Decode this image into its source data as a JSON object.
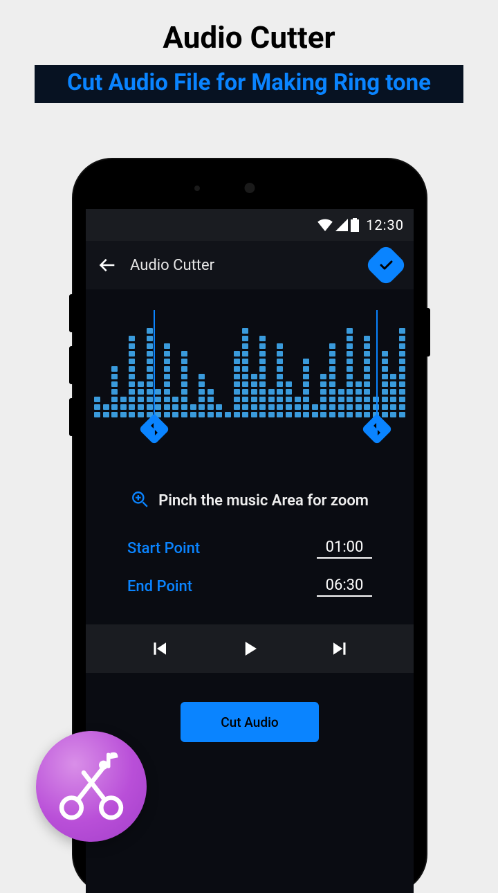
{
  "page": {
    "title": "Audio Cutter",
    "banner": "Cut Audio File for Making Ring tone"
  },
  "status": {
    "time": "12:30"
  },
  "appbar": {
    "title": "Audio Cutter"
  },
  "hint": {
    "text": "Pinch the music Area for zoom"
  },
  "points": {
    "start_label": "Start Point",
    "start_value": "01:00",
    "end_label": "End Point",
    "end_value": "06:30"
  },
  "actions": {
    "cut_label": "Cut Audio"
  },
  "waveform_heights": [
    3,
    2,
    7,
    3,
    11,
    5,
    12,
    4,
    10,
    3,
    9,
    2,
    6,
    4,
    2,
    1,
    9,
    12,
    6,
    11,
    4,
    10,
    5,
    3,
    8,
    2,
    6,
    10,
    4,
    12,
    5,
    11,
    3,
    9,
    6,
    12
  ]
}
